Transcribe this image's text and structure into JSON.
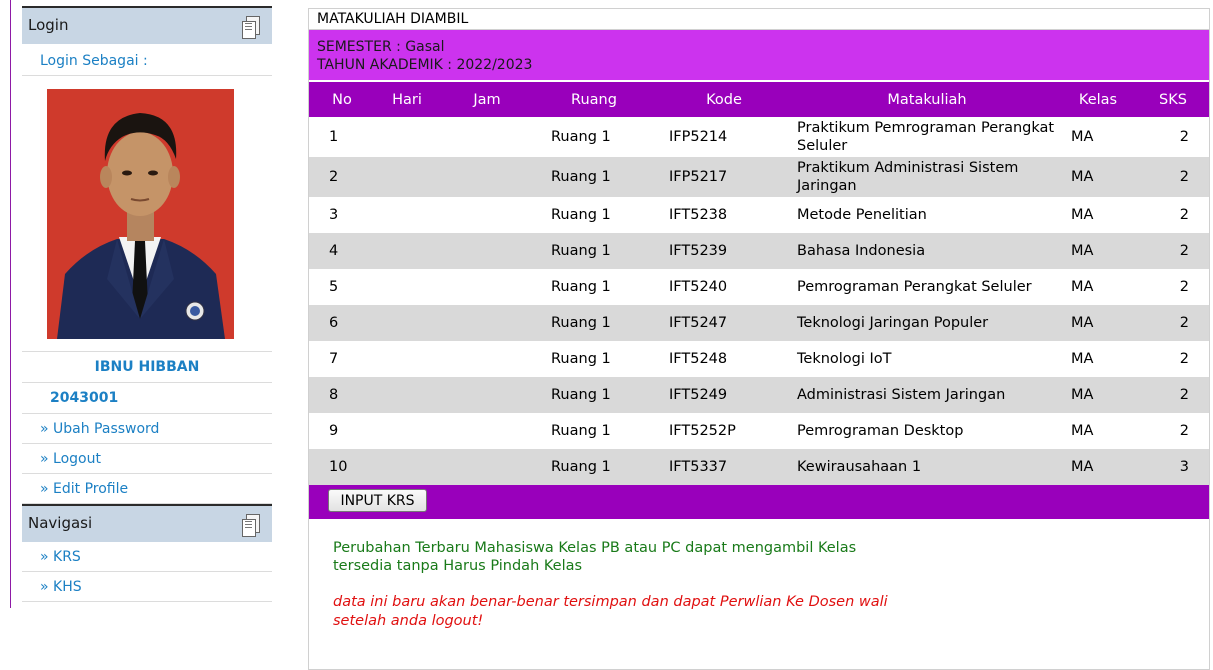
{
  "sidebar": {
    "login_title": "Login",
    "login_as": "Login Sebagai :",
    "student_name": "IBNU HIBBAN",
    "student_id": "2043001",
    "links": [
      "» Ubah Password",
      "» Logout",
      "» Edit Profile"
    ],
    "nav_title": "Navigasi",
    "nav_links": [
      "» KRS",
      "» KHS"
    ]
  },
  "main": {
    "title": "MATAKULIAH DIAMBIL",
    "semester": "SEMESTER : Gasal",
    "academic_year": "TAHUN AKADEMIK : 2022/2023",
    "columns": [
      "No",
      "Hari",
      "Jam",
      "Ruang",
      "Kode",
      "Matakuliah",
      "Kelas",
      "SKS"
    ],
    "rows": [
      {
        "no": "1",
        "hari": "",
        "jam": "",
        "ruang": "Ruang 1",
        "kode": "IFP5214",
        "matakuliah": "Praktikum Pemrograman Perangkat Seluler",
        "kelas": "MA",
        "sks": "2"
      },
      {
        "no": "2",
        "hari": "",
        "jam": "",
        "ruang": "Ruang 1",
        "kode": "IFP5217",
        "matakuliah": "Praktikum Administrasi Sistem Jaringan",
        "kelas": "MA",
        "sks": "2"
      },
      {
        "no": "3",
        "hari": "",
        "jam": "",
        "ruang": "Ruang 1",
        "kode": "IFT5238",
        "matakuliah": "Metode Penelitian",
        "kelas": "MA",
        "sks": "2"
      },
      {
        "no": "4",
        "hari": "",
        "jam": "",
        "ruang": "Ruang 1",
        "kode": "IFT5239",
        "matakuliah": "Bahasa Indonesia",
        "kelas": "MA",
        "sks": "2"
      },
      {
        "no": "5",
        "hari": "",
        "jam": "",
        "ruang": "Ruang 1",
        "kode": "IFT5240",
        "matakuliah": "Pemrograman Perangkat Seluler",
        "kelas": "MA",
        "sks": "2"
      },
      {
        "no": "6",
        "hari": "",
        "jam": "",
        "ruang": "Ruang 1",
        "kode": "IFT5247",
        "matakuliah": "Teknologi Jaringan Populer",
        "kelas": "MA",
        "sks": "2"
      },
      {
        "no": "7",
        "hari": "",
        "jam": "",
        "ruang": "Ruang 1",
        "kode": "IFT5248",
        "matakuliah": "Teknologi IoT",
        "kelas": "MA",
        "sks": "2"
      },
      {
        "no": "8",
        "hari": "",
        "jam": "",
        "ruang": "Ruang 1",
        "kode": "IFT5249",
        "matakuliah": "Administrasi Sistem Jaringan",
        "kelas": "MA",
        "sks": "2"
      },
      {
        "no": "9",
        "hari": "",
        "jam": "",
        "ruang": "Ruang 1",
        "kode": "IFT5252P",
        "matakuliah": "Pemrograman Desktop",
        "kelas": "MA",
        "sks": "2"
      },
      {
        "no": "10",
        "hari": "",
        "jam": "",
        "ruang": "Ruang 1",
        "kode": "IFT5337",
        "matakuliah": "Kewirausahaan 1",
        "kelas": "MA",
        "sks": "3"
      }
    ],
    "input_button": "INPUT KRS",
    "note_green": "Perubahan Terbaru Mahasiswa Kelas PB atau PC dapat mengambil Kelas tersedia tanpa Harus Pindah Kelas",
    "note_red": "data ini baru akan benar-benar tersimpan dan dapat Perwlian Ke Dosen wali setelah anda logout!"
  },
  "colors": {
    "purple_header": "#9900bb",
    "semester_bg": "#cc33ee",
    "link_blue": "#1c80c4",
    "sidebar_head": "#c8d6e4"
  }
}
